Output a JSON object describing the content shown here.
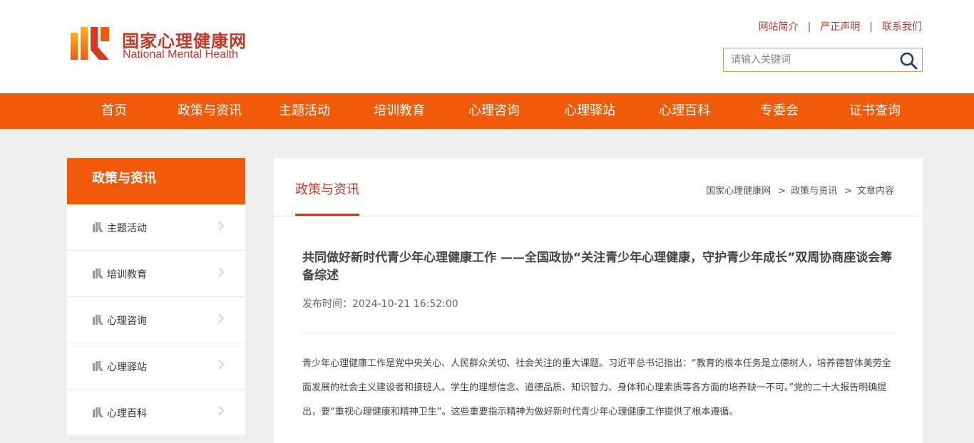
{
  "header": {
    "logo_cn": "国家心理健康网",
    "logo_en": "National Mental Health",
    "toplinks": [
      "网站简介",
      "严正声明",
      "联系我们"
    ],
    "search_placeholder": "请输入关键词",
    "search_icon": "magnifier-icon"
  },
  "nav": {
    "items": [
      "首页",
      "政策与资讯",
      "主题活动",
      "培训教育",
      "心理咨询",
      "心理驿站",
      "心理百科",
      "专委会",
      "证书查询"
    ]
  },
  "sidebar": {
    "title": "政策与资讯",
    "items": [
      "主题活动",
      "培训教育",
      "心理咨询",
      "心理驿站",
      "心理百科"
    ]
  },
  "main": {
    "section_title": "政策与资讯",
    "breadcrumb": [
      "国家心理健康网",
      "政策与资讯",
      "文章内容"
    ],
    "article_title": "共同做好新时代青少年心理健康工作 ——全国政协“关注青少年心理健康，守护青少年成长”双周协商座谈会筹备综述",
    "publish_label": "发布时间：",
    "publish_time": "2024-10-21 16:52:00",
    "body": "青少年心理健康工作是党中央关心、人民群众关切、社会关注的重大课题。习近平总书记指出：“教育的根本任务是立德树人，培养德智体美劳全面发展的社会主义建设者和接班人。学生的理想信念、道德品质、知识智力、身体和心理素质等各方面的培养缺一不可。”党的二十大报告明确提出，要“重视心理健康和精神卫生”。这些重要指示精神为做好新时代青少年心理健康工作提供了根本遵循。"
  },
  "colors": {
    "brand_orange": "#f05a0a",
    "brand_red": "#c0392b"
  }
}
